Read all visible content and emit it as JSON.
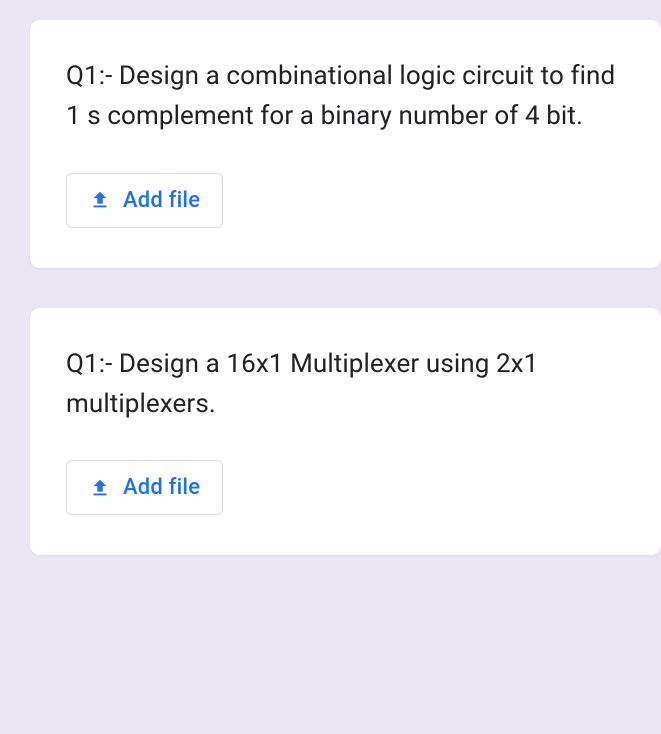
{
  "questions": [
    {
      "text": "Q1:- Design a combinational logic circuit to find 1 s complement for a binary number of 4 bit.",
      "button_label": "Add file"
    },
    {
      "text": "Q1:- Design a 16x1 Multiplexer using 2x1 multiplexers.",
      "button_label": "Add file"
    }
  ]
}
